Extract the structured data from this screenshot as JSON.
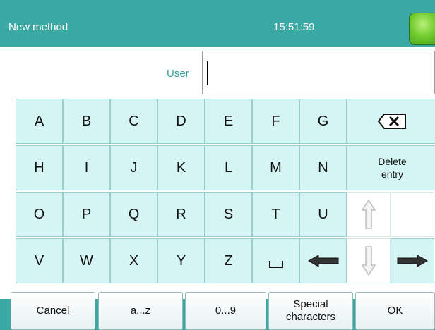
{
  "header": {
    "title": "New method",
    "time": "15:51:59"
  },
  "input": {
    "label": "User",
    "value": ""
  },
  "keyboard": {
    "row1": [
      "A",
      "B",
      "C",
      "D",
      "E",
      "F",
      "G"
    ],
    "row2": [
      "H",
      "I",
      "J",
      "K",
      "L",
      "M",
      "N"
    ],
    "row3": [
      "O",
      "P",
      "Q",
      "R",
      "S",
      "T",
      "U"
    ],
    "row4": [
      "V",
      "W",
      "X",
      "Y",
      "Z"
    ],
    "delete_entry": "Delete\nentry"
  },
  "footer": {
    "cancel": "Cancel",
    "lowercase": "a...z",
    "numbers": "0...9",
    "special": "Special characters",
    "ok": "OK"
  },
  "icons": {
    "backspace": "backspace-icon",
    "space": "space-icon",
    "arrow_left": "arrow-left-icon",
    "arrow_up": "arrow-up-icon",
    "arrow_down": "arrow-down-icon",
    "arrow_right": "arrow-right-icon"
  },
  "colors": {
    "header": "#3aa8a3",
    "key": "#d4f5f3",
    "label": "#2f9c98",
    "status": "#6fcb2c"
  }
}
